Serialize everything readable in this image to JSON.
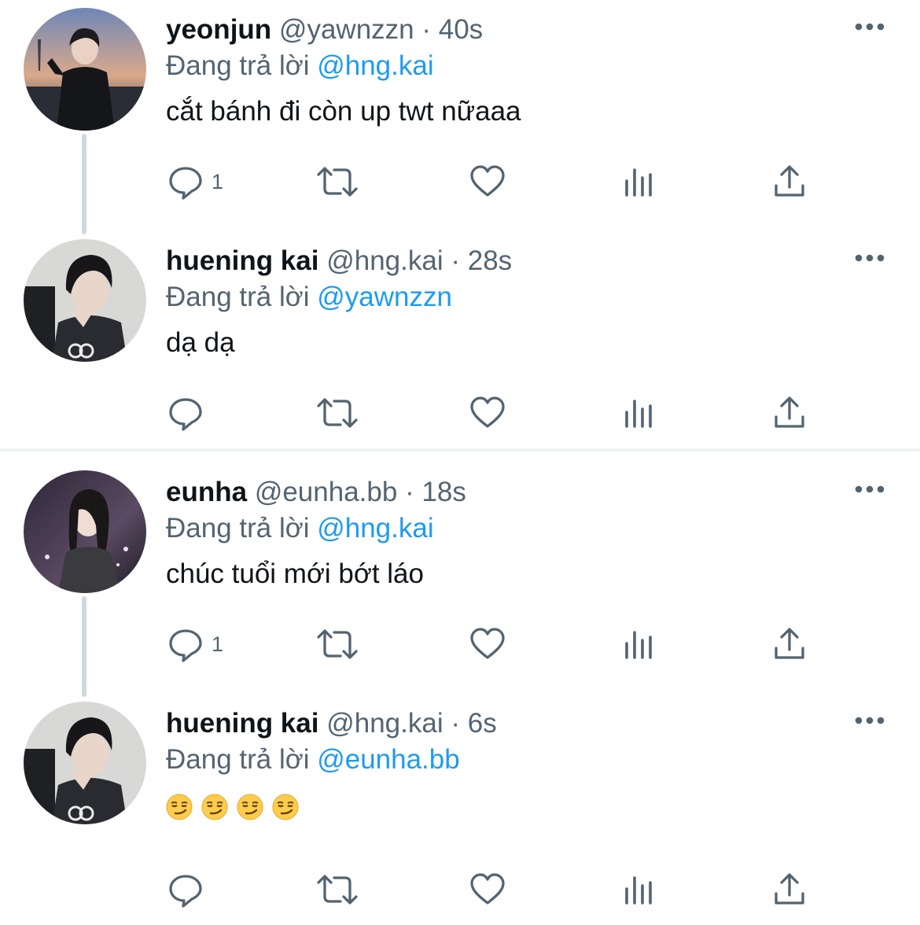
{
  "reply_prefix": "Đang trả lời",
  "colors": {
    "link": "#1d9bf0",
    "muted": "#536471",
    "text": "#0f1419"
  },
  "tweets": [
    {
      "name": "yeonjun",
      "handle": "@yawnzzn",
      "sep": "·",
      "time": "40s",
      "reply_to": "@hng.kai",
      "text": "cắt bánh đi còn up twt nữaaa",
      "reply_count": "1",
      "avatar_icon": "avatar-photo-yeonjun"
    },
    {
      "name": "huening kai",
      "handle": "@hng.kai",
      "sep": "·",
      "time": "28s",
      "reply_to": "@yawnzzn",
      "text": "dạ dạ",
      "reply_count": "",
      "avatar_icon": "avatar-photo-hueningkai"
    },
    {
      "name": "eunha",
      "handle": "@eunha.bb",
      "sep": "·",
      "time": "18s",
      "reply_to": "@hng.kai",
      "text": "chúc tuổi mới bớt láo",
      "reply_count": "1",
      "avatar_icon": "avatar-photo-eunha"
    },
    {
      "name": "huening kai",
      "handle": "@hng.kai",
      "sep": "·",
      "time": "6s",
      "reply_to": "@eunha.bb",
      "text": "",
      "emojis": [
        "smirking-face-emoji",
        "smirking-face-emoji",
        "smirking-face-emoji",
        "smirking-face-emoji"
      ],
      "reply_count": "",
      "avatar_icon": "avatar-photo-hueningkai"
    }
  ]
}
